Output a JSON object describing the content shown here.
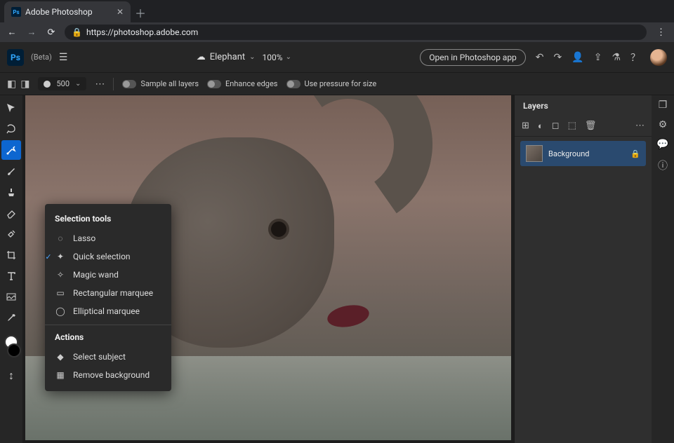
{
  "browser": {
    "tab_title": "Adobe Photoshop",
    "url": "https://photoshop.adobe.com"
  },
  "appbar": {
    "beta_label": "(Beta)",
    "document_name": "Elephant",
    "zoom": "100%",
    "open_in_app": "Open in Photoshop app"
  },
  "options_bar": {
    "brush_size": "500",
    "sample_all_layers": "Sample all layers",
    "enhance_edges": "Enhance edges",
    "use_pressure": "Use pressure for size"
  },
  "flyout": {
    "header_tools": "Selection tools",
    "items_tools": [
      {
        "label": "Lasso",
        "selected": false
      },
      {
        "label": "Quick selection",
        "selected": true
      },
      {
        "label": "Magic wand",
        "selected": false
      },
      {
        "label": "Rectangular marquee",
        "selected": false
      },
      {
        "label": "Elliptical marquee",
        "selected": false
      }
    ],
    "header_actions": "Actions",
    "items_actions": [
      {
        "label": "Select subject"
      },
      {
        "label": "Remove background"
      }
    ]
  },
  "layers": {
    "panel_title": "Layers",
    "items": [
      {
        "name": "Background",
        "locked": true
      }
    ]
  }
}
